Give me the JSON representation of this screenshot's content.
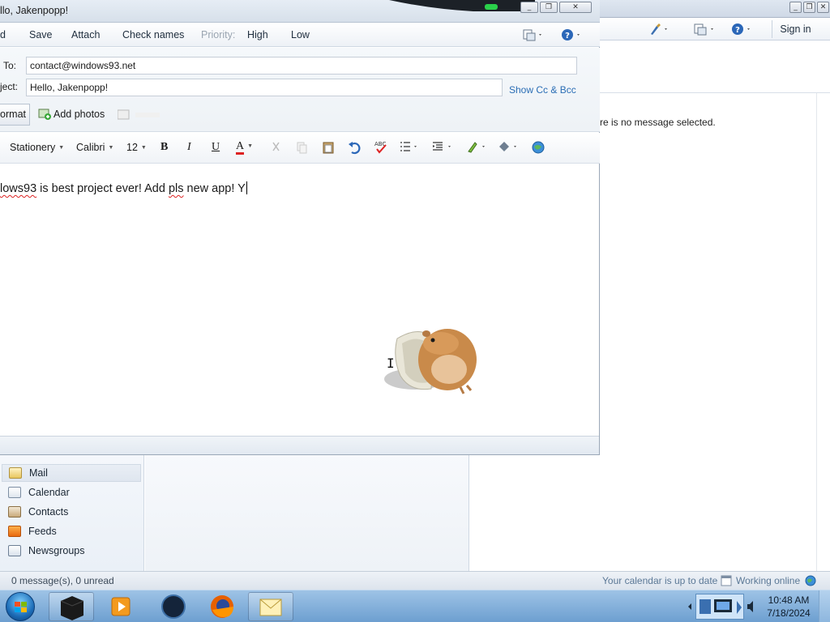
{
  "background_window": {
    "sign_in": "Sign in",
    "no_message": "re is no message selected."
  },
  "compose": {
    "title": "llo, Jakenpopp!",
    "toolbar": {
      "send": "d",
      "save": "Save",
      "attach": "Attach",
      "check_names": "Check names",
      "priority": "Priority:",
      "high": "High",
      "low": "Low"
    },
    "fields": {
      "to_label": "To:",
      "to_value": "contact@windows93.net",
      "subject_label": "ject:",
      "subject_value": "Hello, Jakenpopp!",
      "show_cc_bcc": "Show Cc & Bcc"
    },
    "tabs": {
      "format": "ormat",
      "add_photos": "Add photos"
    },
    "format_bar": {
      "stationery": "Stationery",
      "font": "Calibri",
      "size": "12",
      "bold": "B",
      "italic": "I",
      "underline": "U",
      "font_color": "A"
    },
    "body": {
      "misspelled": "lows93",
      "text_mid": " is best project ever! Add ",
      "misspelled_2": "pls",
      "text_end": " new app! Y"
    }
  },
  "nav": {
    "items": [
      {
        "label": "Mail",
        "icon": "mail-icon",
        "selected": true
      },
      {
        "label": "Calendar",
        "icon": "calendar-icon",
        "selected": false
      },
      {
        "label": "Contacts",
        "icon": "contacts-icon",
        "selected": false
      },
      {
        "label": "Feeds",
        "icon": "feeds-icon",
        "selected": false
      },
      {
        "label": "Newsgroups",
        "icon": "newsgroups-icon",
        "selected": false
      }
    ]
  },
  "status": {
    "messages": "0 message(s), 0 unread",
    "calendar": "Your calendar is up to date",
    "online": "Working online"
  },
  "taskbar": {
    "time": "10:48 AM",
    "date": "7/18/2024"
  },
  "colors": {
    "accent_link": "#2a6db5",
    "taskbar": "#7aa7d6",
    "spelling_error": "#dd2222"
  }
}
